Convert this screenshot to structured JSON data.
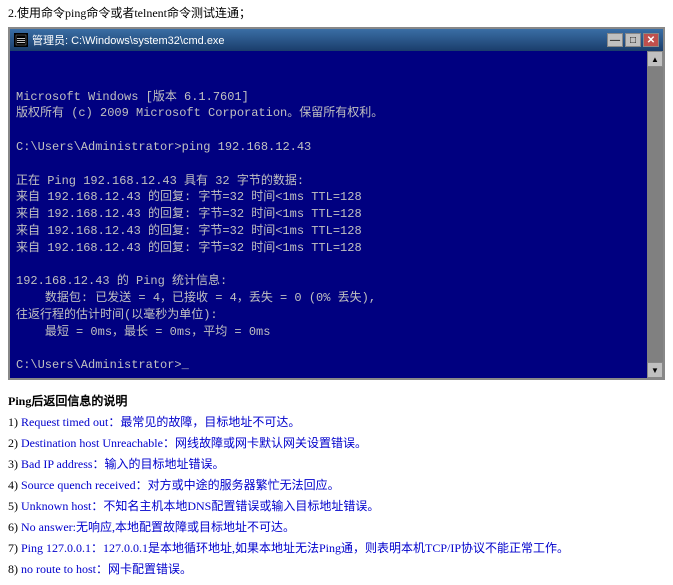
{
  "top_instruction": "2.使用命令ping命令或者telnent命令测试连通；",
  "cmd": {
    "titlebar_title": "管理员: C:\\Windows\\system32\\cmd.exe",
    "icon": "▣",
    "btn_min": "—",
    "btn_max": "□",
    "btn_close": "✕",
    "lines": [
      "Microsoft Windows [版本 6.1.7601]",
      "版权所有 (c) 2009 Microsoft Corporation。保留所有权利。",
      "",
      "C:\\Users\\Administrator>ping 192.168.12.43",
      "",
      "正在 Ping 192.168.12.43 具有 32 字节的数据:",
      "来自 192.168.12.43 的回复: 字节=32 时间<1ms TTL=128",
      "来自 192.168.12.43 的回复: 字节=32 时间<1ms TTL=128",
      "来自 192.168.12.43 的回复: 字节=32 时间<1ms TTL=128",
      "来自 192.168.12.43 的回复: 字节=32 时间<1ms TTL=128",
      "",
      "192.168.12.43 的 Ping 统计信息:",
      "    数据包: 已发送 = 4，已接收 = 4，丢失 = 0 (0% 丢失),",
      "往返行程的估计时间(以毫秒为单位):",
      "    最短 = 0ms，最长 = 0ms，平均 = 0ms",
      "",
      "C:\\Users\\Administrator>_"
    ]
  },
  "ping_info": {
    "title": "Ping后返回信息的说明",
    "items": [
      {
        "number": "1)",
        "text": "Request timed out：最常见的故障，目标地址不可达。"
      },
      {
        "number": "2)",
        "text": "Destination host Unreachable：网线故障或网卡默认网关设置错误。"
      },
      {
        "number": "3)",
        "text": "Bad IP address：输入的目标地址错误。"
      },
      {
        "number": "4)",
        "text": "Source quench received：对方或中途的服务器繁忙无法回应。"
      },
      {
        "number": "5)",
        "text": "Unknown host：不知名主机本地DNS配置错误或输入目标地址错误。"
      },
      {
        "number": "6)",
        "text": "No answer:无响应,本地配置故障或目标地址不可达。"
      },
      {
        "number": "7)",
        "text": "Ping 127.0.0.1：127.0.0.1是本地循环地址,如果本地址无法Ping通，则表明本机TCP/IP协议不能正常工作。"
      },
      {
        "number": "8)",
        "text": "no route to host：网卡配置错误。"
      }
    ]
  }
}
